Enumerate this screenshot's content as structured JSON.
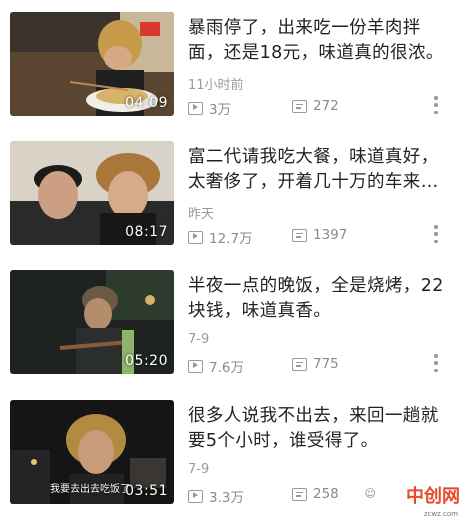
{
  "videos": [
    {
      "title": "暴雨停了，出来吃一份羊肉拌面，还是18元，味道真的很浓。",
      "time": "11小时前",
      "duration": "04:09",
      "plays": "3万",
      "comments": "272",
      "subtitle": ""
    },
    {
      "title": "富二代请我吃大餐，味道真好，太奢侈了，开着几十万的车来…",
      "time": "昨天",
      "duration": "08:17",
      "plays": "12.7万",
      "comments": "1397",
      "subtitle": ""
    },
    {
      "title": "半夜一点的晚饭，全是烧烤，22块钱，味道真香。",
      "time": "7-9",
      "duration": "05:20",
      "plays": "7.6万",
      "comments": "775",
      "subtitle": ""
    },
    {
      "title": "很多人说我不出去，来回一趟就要5个小时，谁受得了。",
      "time": "7-9",
      "duration": "03:51",
      "plays": "3.3万",
      "comments": "258",
      "subtitle": "我要去出去吃饭了"
    }
  ],
  "watermark": {
    "logo": "中创网",
    "sub": "zcwz.com"
  },
  "icons": {
    "play": "play-count-icon",
    "comment": "comment-count-icon",
    "more": "more-vertical-icon"
  }
}
